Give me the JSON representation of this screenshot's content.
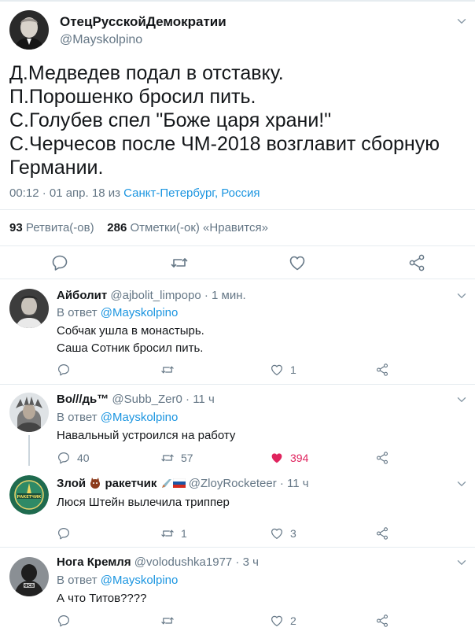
{
  "main_tweet": {
    "display_name": "ОтецРусскойДемократии",
    "handle": "@Mayskolpino",
    "lines": [
      "Д.Медведев подал в отставку.",
      "П.Порошенко бросил пить.",
      "С.Голубев спел \"Боже царя храни!\"",
      "С.Черчесов после ЧМ-2018 возглавит сборную",
      "Германии."
    ],
    "time_date": "00:12 · 01 апр. 18 из ",
    "location": "Санкт-Петербург, Россия",
    "retweets_count": "93",
    "retweets_label": "Ретвита(-ов)",
    "likes_count": "286",
    "likes_label": "Отметки(-ок) «Нравится»"
  },
  "replies": [
    {
      "display_name": "Айболит",
      "handle": "@ajbolit_limpopo",
      "time": " · 1 мин.",
      "reply_prefix": "В ответ ",
      "reply_to": "@Mayskolpino",
      "lines": [
        "Собчак ушла в монастырь.",
        "Саша Сотник бросил пить."
      ],
      "reply_count": "",
      "retweet_count": "",
      "like_count": "1"
    },
    {
      "display_name": "Во///дь™",
      "handle": "@Subb_Zer0",
      "time": " · 11 ч",
      "reply_prefix": "В ответ ",
      "reply_to": "@Mayskolpino",
      "lines": [
        "Навальный устроился на работу"
      ],
      "reply_count": "40",
      "retweet_count": "57",
      "like_count": "394"
    },
    {
      "display_name": "Злой",
      "display_name_2": "ракетчик",
      "handle": "@ZloyRocketeer",
      "time": " · 11 ч",
      "lines": [
        "Люся Штейн вылечила триппер"
      ],
      "reply_count": "",
      "retweet_count": "1",
      "like_count": "3",
      "avatar_text_top": "ДАЛЬНЯЯ СТРАТЕГИЧЕСКАЯ",
      "avatar_text_mid": "РАКЕТЧИК",
      "avatar_text_bottom": "СТРАНЫ"
    },
    {
      "display_name": "Нога Кремля",
      "handle": "@volodushka1977",
      "time": " · 3 ч",
      "reply_prefix": "В ответ ",
      "reply_to": "@Mayskolpino",
      "lines": [
        "А что Титов????"
      ],
      "reply_count": "",
      "retweet_count": "",
      "like_count": "2",
      "avatar_badge": "ФСБ"
    }
  ],
  "icons": {
    "reply": "reply-icon",
    "retweet": "retweet-icon",
    "like": "heart-icon",
    "share": "share-icon",
    "caret": "chevron-down-icon"
  },
  "colors": {
    "link": "#1b95e0",
    "secondary_text": "#657786",
    "like_active": "#e0245e",
    "divider": "#e6ecf0"
  }
}
